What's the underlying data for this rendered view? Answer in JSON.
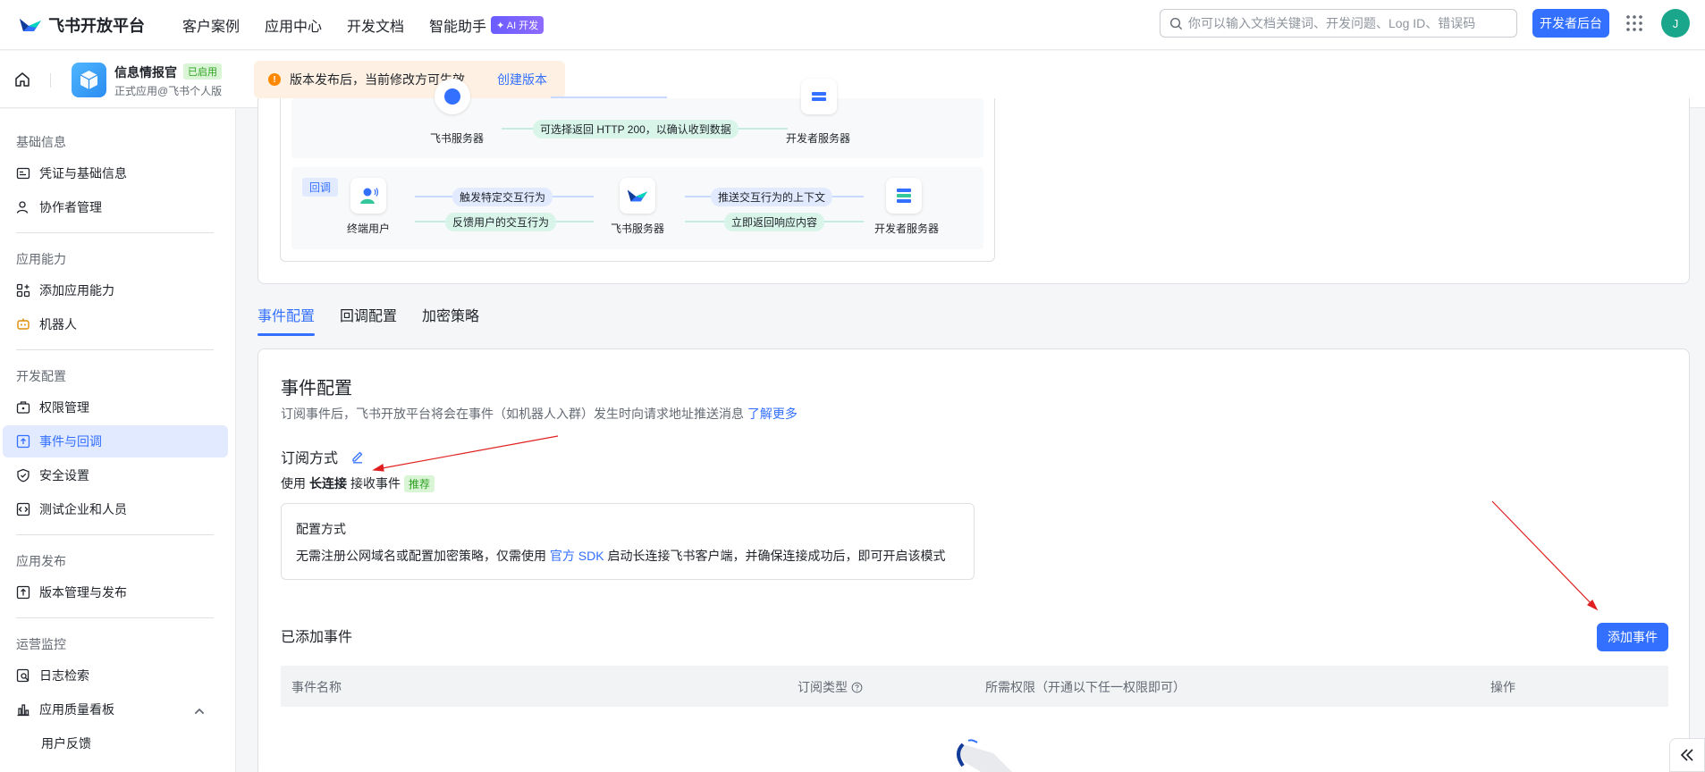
{
  "brand": {
    "name": "飞书开放平台",
    "accent": "#3370ff"
  },
  "topnav": {
    "items": [
      "客户案例",
      "应用中心",
      "开发文档",
      "智能助手"
    ],
    "ai_badge": "✦ AI 开发",
    "search_placeholder": "你可以输入文档关键词、开发问题、Log ID、错误码",
    "dev_button": "开发者后台",
    "avatar_initial": "J"
  },
  "appbar": {
    "app_name": "信息情报官",
    "status": "已启用",
    "subtitle": "正式应用@飞书个人版",
    "notice": "版本发布后，当前修改方可生效",
    "notice_link": "创建版本"
  },
  "sidebar": {
    "groups": [
      {
        "title": "基础信息",
        "items": [
          "凭证与基础信息",
          "协作者管理"
        ]
      },
      {
        "title": "应用能力",
        "items": [
          "添加应用能力",
          "机器人"
        ]
      },
      {
        "title": "开发配置",
        "items": [
          "权限管理",
          "事件与回调",
          "安全设置",
          "测试企业和人员"
        ]
      },
      {
        "title": "应用发布",
        "items": [
          "版本管理与发布"
        ]
      },
      {
        "title": "运营监控",
        "items": [
          "日志检索",
          "应用质量看板",
          "用户反馈"
        ]
      }
    ],
    "active": "事件与回调"
  },
  "flow": {
    "top_row": {
      "left_label": "飞书服务器",
      "right_label": "开发者服务器",
      "return_pill": "可选择返回 HTTP 200，以确认收到数据"
    },
    "callback_row": {
      "tag": "回调",
      "node1": "终端用户",
      "node2": "飞书服务器",
      "node3": "开发者服务器",
      "pill1": "触发特定交互行为",
      "pill2": "反馈用户的交互行为",
      "pill3": "推送交互行为的上下文",
      "pill4": "立即返回响应内容"
    }
  },
  "tabs": [
    "事件配置",
    "回调配置",
    "加密策略"
  ],
  "event_config": {
    "title": "事件配置",
    "desc": "订阅事件后，飞书开放平台将会在事件（如机器人入群）发生时向请求地址推送消息",
    "learn_more": "了解更多",
    "subscribe_title": "订阅方式",
    "use_prefix": "使用",
    "use_mode": "长连接",
    "use_suffix": "接收事件",
    "recommended": "推荐",
    "config_title": "配置方式",
    "config_desc_1": "无需注册公网域名或配置加密策略，仅需使用",
    "config_link": "官方 SDK",
    "config_desc_2": "启动长连接飞书客户端，并确保连接成功后，即可开启该模式",
    "added_title": "已添加事件",
    "add_button": "添加事件",
    "table_headers": [
      "事件名称",
      "订阅类型",
      "所需权限（开通以下任一权限即可）",
      "操作"
    ]
  }
}
